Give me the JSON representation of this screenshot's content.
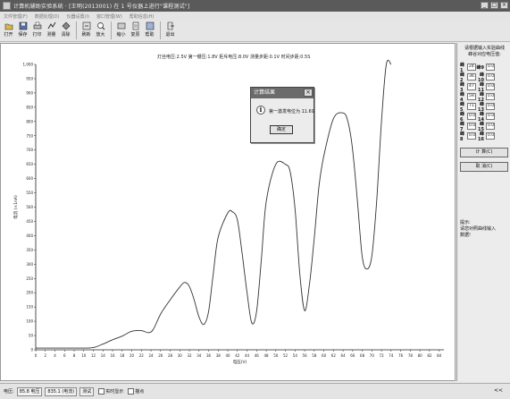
{
  "window": {
    "title": "计算机辅助实验系统 · [王明(2013001) 在 1 号仪器上进行\"课程测试\"]",
    "minimize": "_",
    "maximize": "□",
    "close": "×"
  },
  "menu": [
    "文件管理(F)",
    "数据处理(D)",
    "仪器设置(I)",
    "窗口管理(W)",
    "帮助信息(H)"
  ],
  "toolbar": [
    {
      "label": "打开",
      "icon": "open-icon"
    },
    {
      "label": "保存",
      "icon": "save-icon"
    },
    {
      "label": "打印",
      "icon": "print-icon"
    },
    {
      "label": "测量",
      "icon": "measure-icon"
    },
    {
      "label": "清除",
      "icon": "clear-icon"
    },
    {
      "label": "刷新",
      "icon": "refresh-icon"
    },
    {
      "label": "放大",
      "icon": "zoom-in-icon"
    },
    {
      "label": "缩小",
      "icon": "zoom-out-icon"
    },
    {
      "label": "复原",
      "icon": "restore-icon"
    },
    {
      "label": "帮助",
      "icon": "help-icon"
    },
    {
      "label": "退出",
      "icon": "exit-icon"
    }
  ],
  "info_line": "灯丝电压:2.5V   第一栅压:1.8V   拒斥电压:8.0V   测量步距:0.1V   时间步距:0.5S",
  "right_panel": {
    "title": "请根据输入实验曲线\n峰谷对应电压值:",
    "rows": [
      {
        "l": "峰1",
        "v": "24.9",
        "l2": "峰9",
        "v2": "0.0"
      },
      {
        "l": "峰2",
        "v": "36.5",
        "l2": "峰10",
        "v2": "0.0"
      },
      {
        "l": "峰3",
        "v": "47",
        "l2": "峰11",
        "v2": "0.0"
      },
      {
        "l": "峰4",
        "v": "59.2",
        "l2": "峰12",
        "v2": "0.0"
      },
      {
        "l": "峰5",
        "v": "71.7",
        "l2": "峰13",
        "v2": "0.0"
      },
      {
        "l": "峰6",
        "v": "0.0",
        "l2": "峰14",
        "v2": "0.0"
      },
      {
        "l": "峰7",
        "v": "0.0",
        "l2": "峰15",
        "v2": "0.0"
      },
      {
        "l": "峰8",
        "v": "0.0",
        "l2": "峰16",
        "v2": "0.0"
      }
    ],
    "btn_calc": "计 算(C)",
    "btn_cancel": "取 消(C)",
    "hint_label": "提示:",
    "hint": "请您对照曲线输入\n数据!"
  },
  "statusbar": {
    "label": "电压:",
    "voltage": "85.8 电压",
    "current": "835.1 (电流)",
    "mode": "测试",
    "chk1": "实时显示",
    "chk2": "描点",
    "right": "<<"
  },
  "dialog": {
    "title": "计算结果",
    "message": "第一激发电位为 11.69",
    "ok": "确定",
    "close": "×",
    "icon": "i"
  },
  "chart_data": {
    "type": "line",
    "xlabel": "电压(V)",
    "ylabel": "电流 (×1nA)",
    "xlim": [
      0,
      85
    ],
    "ylim": [
      0,
      1000
    ],
    "xticks": [
      0,
      2,
      4,
      6,
      8,
      10,
      12,
      14,
      16,
      18,
      20,
      22,
      24,
      26,
      28,
      30,
      32,
      34,
      36,
      38,
      40,
      42,
      44,
      46,
      48,
      50,
      52,
      54,
      56,
      58,
      60,
      62,
      64,
      66,
      68,
      70,
      72,
      74,
      76,
      78,
      80,
      82,
      84
    ],
    "yticks": [
      0,
      50,
      100,
      150,
      200,
      250,
      300,
      350,
      400,
      450,
      500,
      550,
      600,
      650,
      700,
      750,
      800,
      850,
      900,
      950,
      1000
    ],
    "x": [
      0,
      2,
      4,
      6,
      8,
      10,
      11.5,
      12.5,
      14,
      16,
      18,
      20,
      22,
      23.5,
      24.5,
      26,
      28,
      30,
      31,
      32,
      33,
      34,
      35,
      36,
      37,
      38,
      40,
      41,
      42,
      43,
      44,
      45,
      46,
      47,
      48,
      50,
      52,
      53,
      54,
      55,
      56,
      57,
      58,
      59,
      60,
      62,
      64,
      65,
      66,
      67,
      68,
      69,
      70,
      71,
      72,
      73,
      74
    ],
    "y": [
      6,
      6,
      6,
      6,
      6,
      6,
      7,
      10,
      20,
      35,
      48,
      65,
      67,
      60,
      72,
      125,
      175,
      220,
      236,
      222,
      175,
      115,
      89,
      135,
      270,
      395,
      480,
      483,
      455,
      335,
      200,
      94,
      135,
      320,
      520,
      650,
      650,
      622,
      495,
      265,
      137,
      230,
      390,
      575,
      680,
      810,
      830,
      800,
      700,
      520,
      325,
      283,
      330,
      520,
      800,
      1000,
      1000
    ]
  }
}
